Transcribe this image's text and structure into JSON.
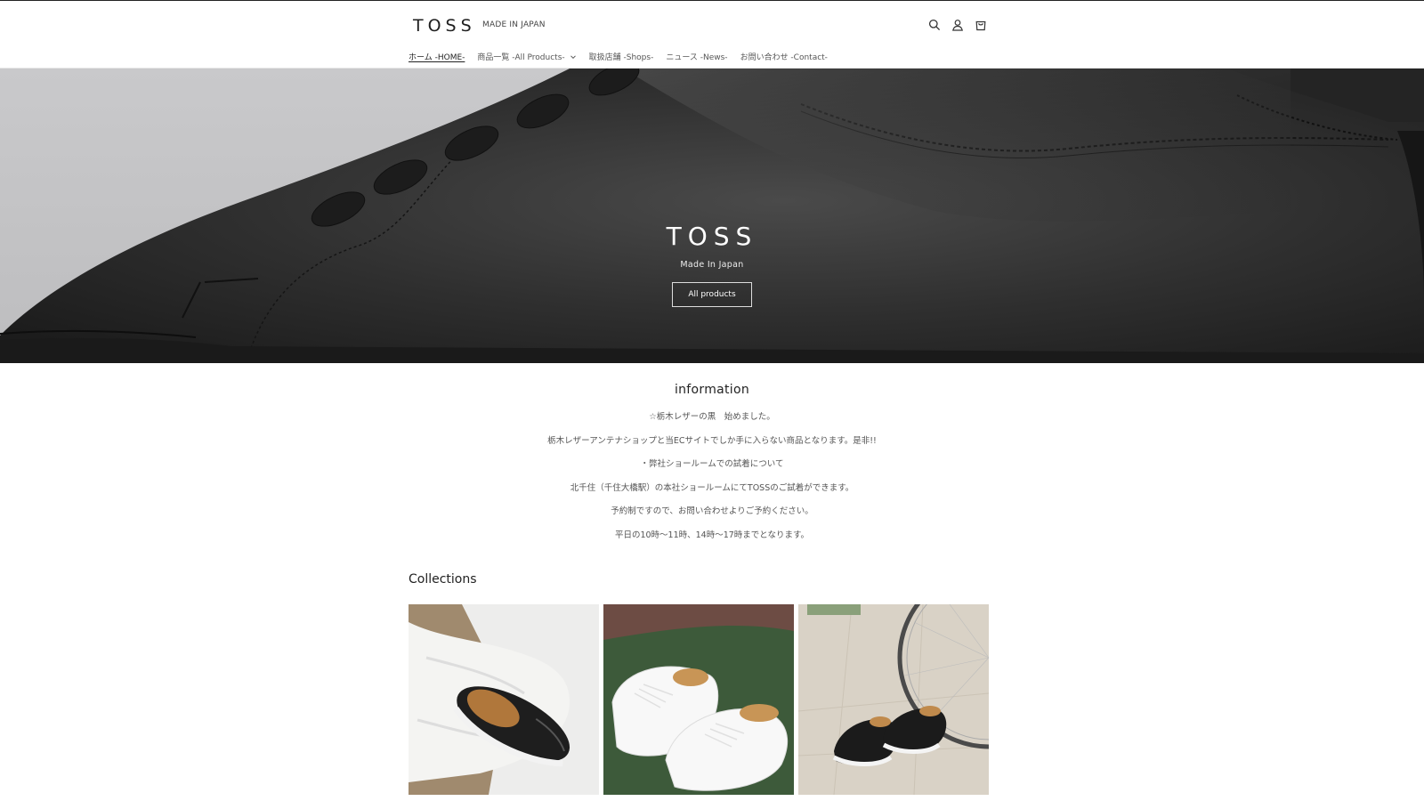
{
  "header": {
    "logo": "TOSS",
    "tagline": "MADE IN JAPAN",
    "icons": [
      "search-icon",
      "account-icon",
      "cart-icon"
    ]
  },
  "nav": {
    "items": [
      {
        "label": "ホーム -HOME-",
        "active": true
      },
      {
        "label": "商品一覧 -All Products-",
        "dropdown": true
      },
      {
        "label": "取扱店舗 -Shops-"
      },
      {
        "label": "ニュース -News-"
      },
      {
        "label": "お問い合わせ -Contact-"
      }
    ]
  },
  "hero": {
    "title": "TOSS",
    "subtitle": "Made In Japan",
    "button": "All products"
  },
  "information": {
    "title": "information",
    "lines": [
      "☆栃木レザーの黒　始めました。",
      "栃木レザーアンテナショップと当ECサイトでしか手に入らない商品となります。是非!!",
      "・弊社ショールームでの試着について",
      "北千住（千住大橋駅）の本社ショールームにてTOSSのご試着ができます。",
      "予約制ですので、お問い合わせよりご予約ください。",
      "平日の10時〜11時、14時〜17時までとなります。"
    ]
  },
  "collections": {
    "title": "Collections",
    "items": [
      {
        "image": "black-slip-on-on-white-pants"
      },
      {
        "image": "white-derby-shoes-on-grass"
      },
      {
        "image": "black-sneakers-with-bicycle"
      }
    ]
  },
  "colors": {
    "hero_bg": "#c4c4c6",
    "leather": "#2e2e2e",
    "text": "#333333"
  }
}
